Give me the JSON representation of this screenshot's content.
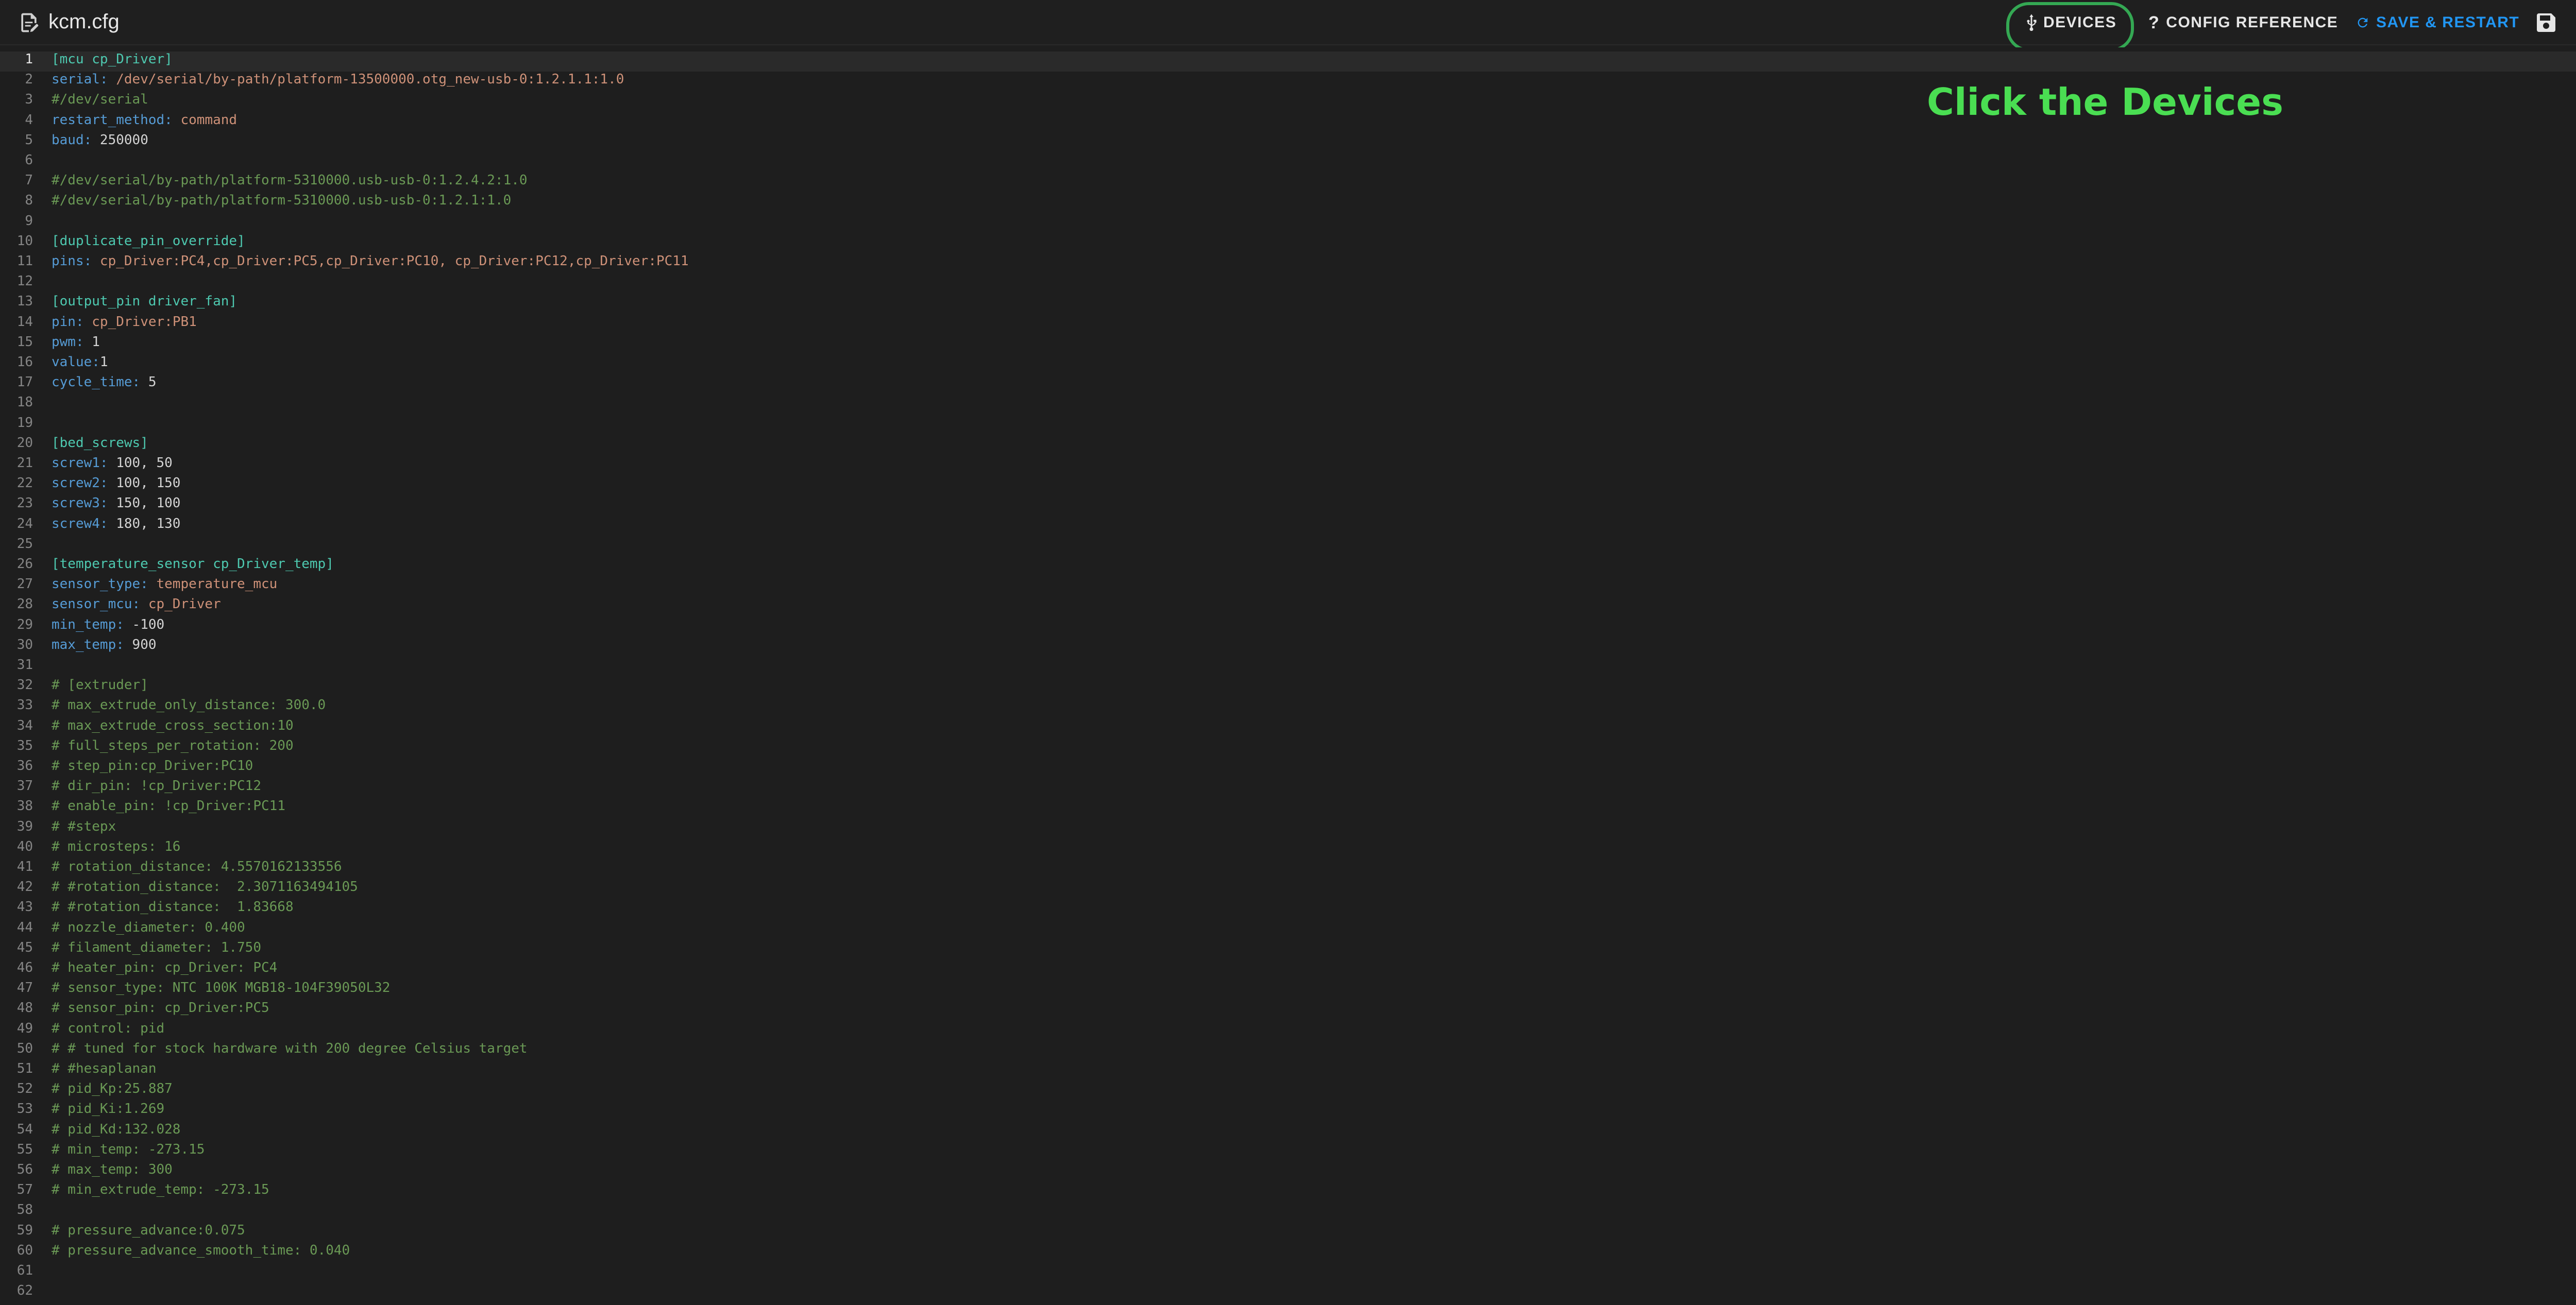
{
  "header": {
    "title": "kcm.cfg",
    "buttons": {
      "devices": "DEVICES",
      "config_reference": "CONFIG REFERENCE",
      "save_restart": "SAVE & RESTART"
    }
  },
  "annotation": "Click the Devices",
  "colors": {
    "accent": "#2196f3",
    "highlight": "#34a853",
    "annotation": "#4ade52"
  },
  "editor": {
    "current_line": 1,
    "lines": [
      [
        [
          "sec",
          "[mcu cp_Driver]"
        ]
      ],
      [
        [
          "key",
          "serial: "
        ],
        [
          "val",
          "/dev/serial/by-path/platform-13500000.otg_new-usb-0:1.2.1.1:1.0"
        ]
      ],
      [
        [
          "com",
          "#/dev/serial"
        ]
      ],
      [
        [
          "key",
          "restart_method: "
        ],
        [
          "val",
          "command"
        ]
      ],
      [
        [
          "key",
          "baud: "
        ],
        [
          "plain",
          "250000"
        ]
      ],
      [],
      [
        [
          "com",
          "#/dev/serial/by-path/platform-5310000.usb-usb-0:1.2.4.2:1.0"
        ]
      ],
      [
        [
          "com",
          "#/dev/serial/by-path/platform-5310000.usb-usb-0:1.2.1:1.0"
        ]
      ],
      [],
      [
        [
          "sec",
          "[duplicate_pin_override]"
        ]
      ],
      [
        [
          "key",
          "pins: "
        ],
        [
          "val",
          "cp_Driver:PC4,cp_Driver:PC5,cp_Driver:PC10, cp_Driver:PC12,cp_Driver:PC11"
        ]
      ],
      [],
      [
        [
          "sec",
          "[output_pin driver_fan]"
        ]
      ],
      [
        [
          "key",
          "pin: "
        ],
        [
          "val",
          "cp_Driver:PB1"
        ]
      ],
      [
        [
          "key",
          "pwm: "
        ],
        [
          "plain",
          "1"
        ]
      ],
      [
        [
          "key",
          "value:"
        ],
        [
          "plain",
          "1"
        ]
      ],
      [
        [
          "key",
          "cycle_time: "
        ],
        [
          "plain",
          "5"
        ]
      ],
      [],
      [],
      [
        [
          "sec",
          "[bed_screws]"
        ]
      ],
      [
        [
          "key",
          "screw1: "
        ],
        [
          "plain",
          "100, 50"
        ]
      ],
      [
        [
          "key",
          "screw2: "
        ],
        [
          "plain",
          "100, 150"
        ]
      ],
      [
        [
          "key",
          "screw3: "
        ],
        [
          "plain",
          "150, 100"
        ]
      ],
      [
        [
          "key",
          "screw4: "
        ],
        [
          "plain",
          "180, 130"
        ]
      ],
      [],
      [
        [
          "sec",
          "[temperature_sensor cp_Driver_temp]"
        ]
      ],
      [
        [
          "key",
          "sensor_type: "
        ],
        [
          "val",
          "temperature_mcu"
        ]
      ],
      [
        [
          "key",
          "sensor_mcu: "
        ],
        [
          "val",
          "cp_Driver"
        ]
      ],
      [
        [
          "key",
          "min_temp: "
        ],
        [
          "plain",
          "-100"
        ]
      ],
      [
        [
          "key",
          "max_temp: "
        ],
        [
          "plain",
          "900"
        ]
      ],
      [],
      [
        [
          "com",
          "# [extruder]"
        ]
      ],
      [
        [
          "com",
          "# max_extrude_only_distance: 300.0"
        ]
      ],
      [
        [
          "com",
          "# max_extrude_cross_section:10"
        ]
      ],
      [
        [
          "com",
          "# full_steps_per_rotation: 200"
        ]
      ],
      [
        [
          "com",
          "# step_pin:cp_Driver:PC10"
        ]
      ],
      [
        [
          "com",
          "# dir_pin: !cp_Driver:PC12"
        ]
      ],
      [
        [
          "com",
          "# enable_pin: !cp_Driver:PC11"
        ]
      ],
      [
        [
          "com",
          "# #stepx"
        ]
      ],
      [
        [
          "com",
          "# microsteps: 16"
        ]
      ],
      [
        [
          "com",
          "# rotation_distance: 4.5570162133556"
        ]
      ],
      [
        [
          "com",
          "# #rotation_distance:  2.3071163494105"
        ]
      ],
      [
        [
          "com",
          "# #rotation_distance:  1.83668"
        ]
      ],
      [
        [
          "com",
          "# nozzle_diameter: 0.400"
        ]
      ],
      [
        [
          "com",
          "# filament_diameter: 1.750"
        ]
      ],
      [
        [
          "com",
          "# heater_pin: cp_Driver: PC4"
        ]
      ],
      [
        [
          "com",
          "# sensor_type: NTC 100K MGB18-104F39050L32"
        ]
      ],
      [
        [
          "com",
          "# sensor_pin: cp_Driver:PC5"
        ]
      ],
      [
        [
          "com",
          "# control: pid"
        ]
      ],
      [
        [
          "com",
          "# # tuned for stock hardware with 200 degree Celsius target"
        ]
      ],
      [
        [
          "com",
          "# #hesaplanan"
        ]
      ],
      [
        [
          "com",
          "# pid_Kp:25.887"
        ]
      ],
      [
        [
          "com",
          "# pid_Ki:1.269"
        ]
      ],
      [
        [
          "com",
          "# pid_Kd:132.028"
        ]
      ],
      [
        [
          "com",
          "# min_temp: -273.15"
        ]
      ],
      [
        [
          "com",
          "# max_temp: 300"
        ]
      ],
      [
        [
          "com",
          "# min_extrude_temp: -273.15"
        ]
      ],
      [],
      [
        [
          "com",
          "# pressure_advance:0.075"
        ]
      ],
      [
        [
          "com",
          "# pressure_advance_smooth_time: 0.040"
        ]
      ],
      [],
      []
    ]
  }
}
